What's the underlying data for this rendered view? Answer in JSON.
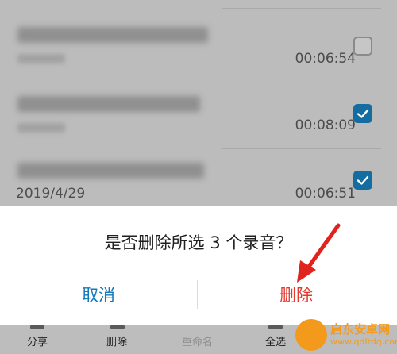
{
  "recordings": [
    {
      "date": "",
      "duration": "00:06:54",
      "checked": false
    },
    {
      "date": "",
      "duration": "00:08:09",
      "checked": true
    },
    {
      "date": "2019/4/29",
      "duration": "00:06:51",
      "checked": true
    }
  ],
  "dialog": {
    "message": "是否删除所选 3 个录音？",
    "cancel_label": "取消",
    "delete_label": "删除"
  },
  "bottom_bar": {
    "share_label": "分享",
    "delete_label": "删除",
    "rename_label": "重命名",
    "select_all_label": "全选"
  },
  "watermark": {
    "name": "启东安卓网",
    "url": "www.qdltdq.com"
  },
  "colors": {
    "accent_blue": "#1478b8",
    "delete_red": "#e43a2e",
    "checkbox_blue": "#146da1",
    "arrow_red": "#e0231c",
    "watermark_orange": "#f39a1c"
  }
}
